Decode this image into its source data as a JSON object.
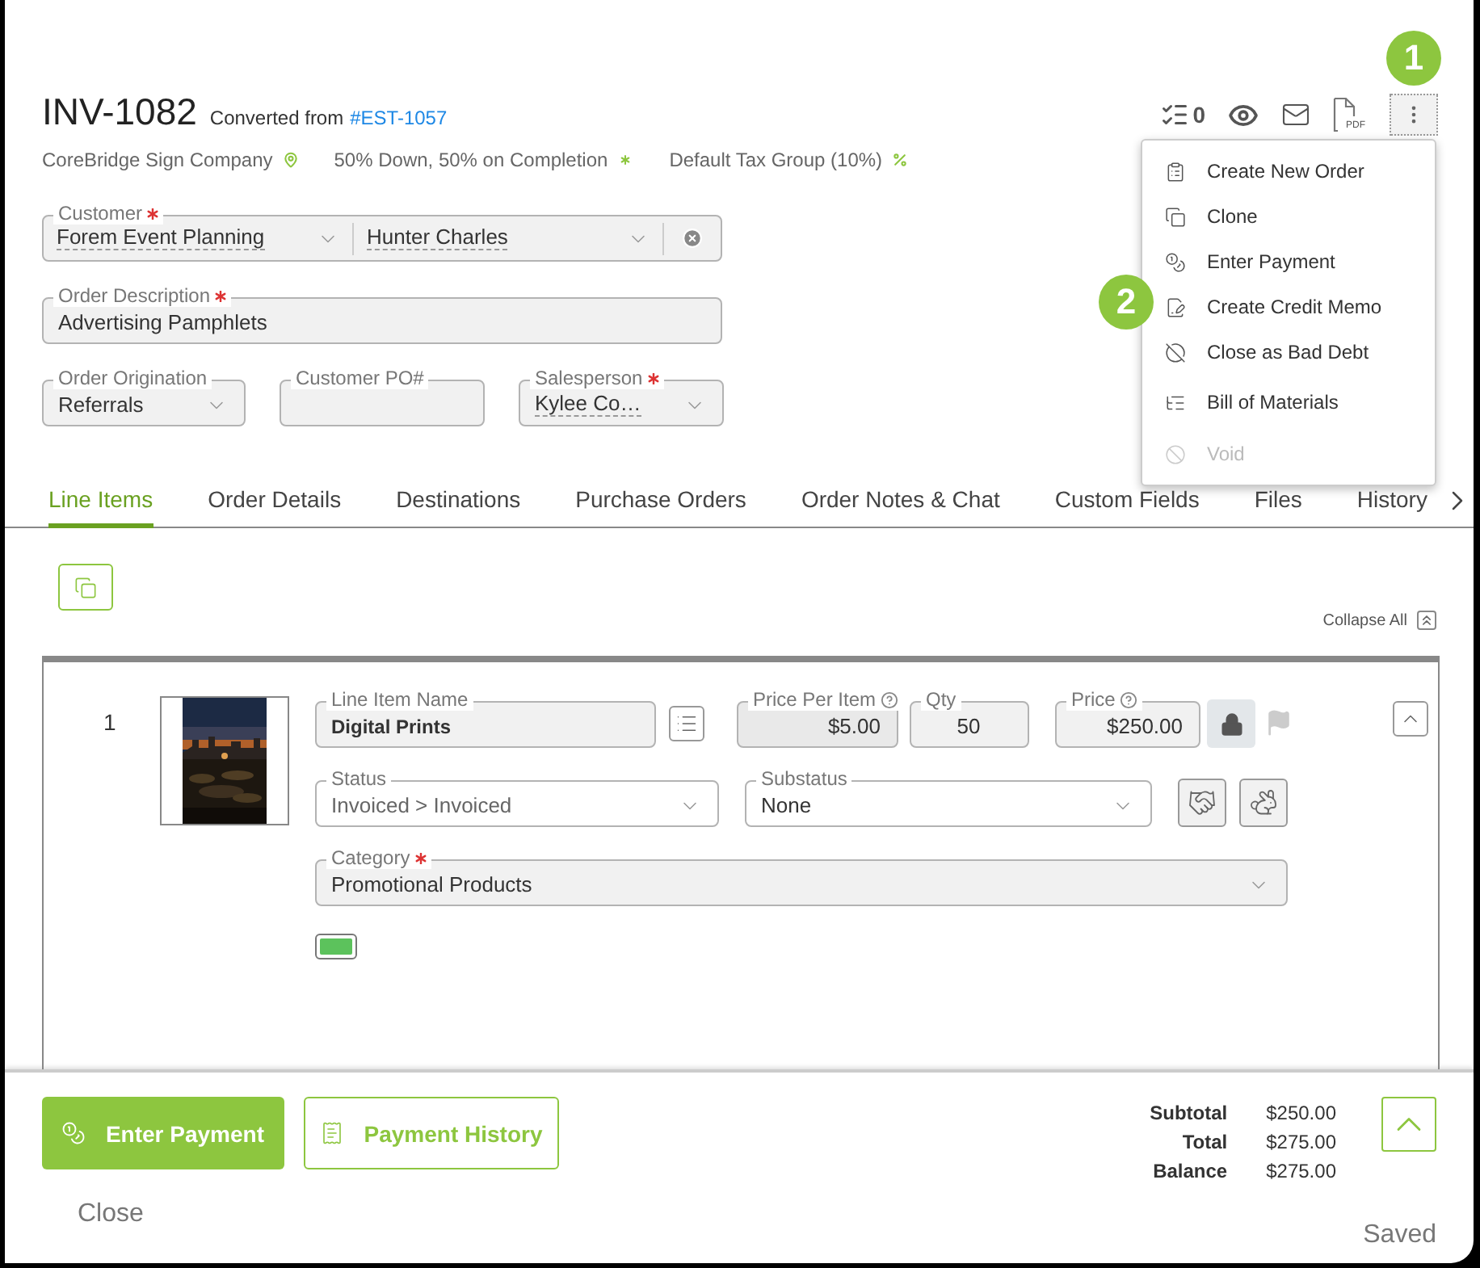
{
  "header": {
    "number": "INV-1082",
    "converted_from": "Converted from",
    "source_link": "#EST-1057"
  },
  "meta": [
    {
      "kind": "location",
      "text": "CoreBridge Sign Company"
    },
    {
      "kind": "terms",
      "text": "50% Down, 50% on Completion"
    },
    {
      "kind": "tax",
      "text": "Default Tax Group (10%)"
    }
  ],
  "toolbar": {
    "task_count": "0",
    "pdf_label": "PDF"
  },
  "callouts": [
    "1",
    "2"
  ],
  "menu": [
    {
      "kind": "order",
      "label": "Create New Order",
      "disabled": false
    },
    {
      "kind": "clone",
      "label": "Clone",
      "disabled": false
    },
    {
      "kind": "payment",
      "label": "Enter Payment",
      "disabled": false
    },
    {
      "kind": "memo",
      "label": "Create Credit Memo",
      "disabled": false
    },
    {
      "kind": "bad_debt",
      "label": "Close as Bad Debt",
      "disabled": false
    },
    {
      "kind": "materials",
      "label": "Bill of Materials",
      "disabled": false
    },
    {
      "kind": "void",
      "label": "Void",
      "disabled": true
    }
  ],
  "customer": {
    "label": "Customer",
    "required": true,
    "company": "Forem Event Planning",
    "contact": "Hunter Charles"
  },
  "order_description": {
    "label": "Order Description",
    "required": true,
    "value": "Advertising Pamphlets"
  },
  "order_origination": {
    "label": "Order Origination",
    "value": "Referrals"
  },
  "customer_po": {
    "label": "Customer PO#"
  },
  "salesperson": {
    "label": "Salesperson",
    "required": true,
    "value": "Kylee Co…"
  },
  "tabs": [
    {
      "label": "Line Items",
      "selected": true
    },
    {
      "label": "Order Details",
      "selected": false
    },
    {
      "label": "Destinations",
      "selected": false
    },
    {
      "label": "Purchase Orders",
      "selected": false
    },
    {
      "label": "Order Notes & Chat",
      "selected": false
    },
    {
      "label": "Custom Fields",
      "selected": false
    },
    {
      "label": "Files",
      "selected": false
    },
    {
      "label": "History",
      "selected": false
    }
  ],
  "collapse_all": "Collapse All",
  "line_items": [
    {
      "number": "1",
      "name": {
        "label": "Line Item Name",
        "value": "Digital Prints"
      },
      "price_per_item": {
        "label": "Price Per Item",
        "value": "$5.00"
      },
      "qty": {
        "label": "Qty",
        "value": "50"
      },
      "price": {
        "label": "Price",
        "value": "$250.00"
      },
      "locked": true,
      "status": {
        "label": "Status",
        "value": "Invoiced > Invoiced"
      },
      "substatus": {
        "label": "Substatus",
        "value": "None"
      },
      "category": {
        "label": "Category",
        "required": true,
        "value": "Promotional Products"
      },
      "color": "#5cc25c"
    }
  ],
  "footer": {
    "enter_payment": "Enter Payment",
    "payment_history": "Payment History",
    "totals": [
      {
        "label": "Subtotal",
        "value": "$250.00"
      },
      {
        "label": "Total",
        "value": "$275.00"
      },
      {
        "label": "Balance",
        "value": "$275.00"
      }
    ],
    "close": "Close",
    "status": "Saved"
  }
}
